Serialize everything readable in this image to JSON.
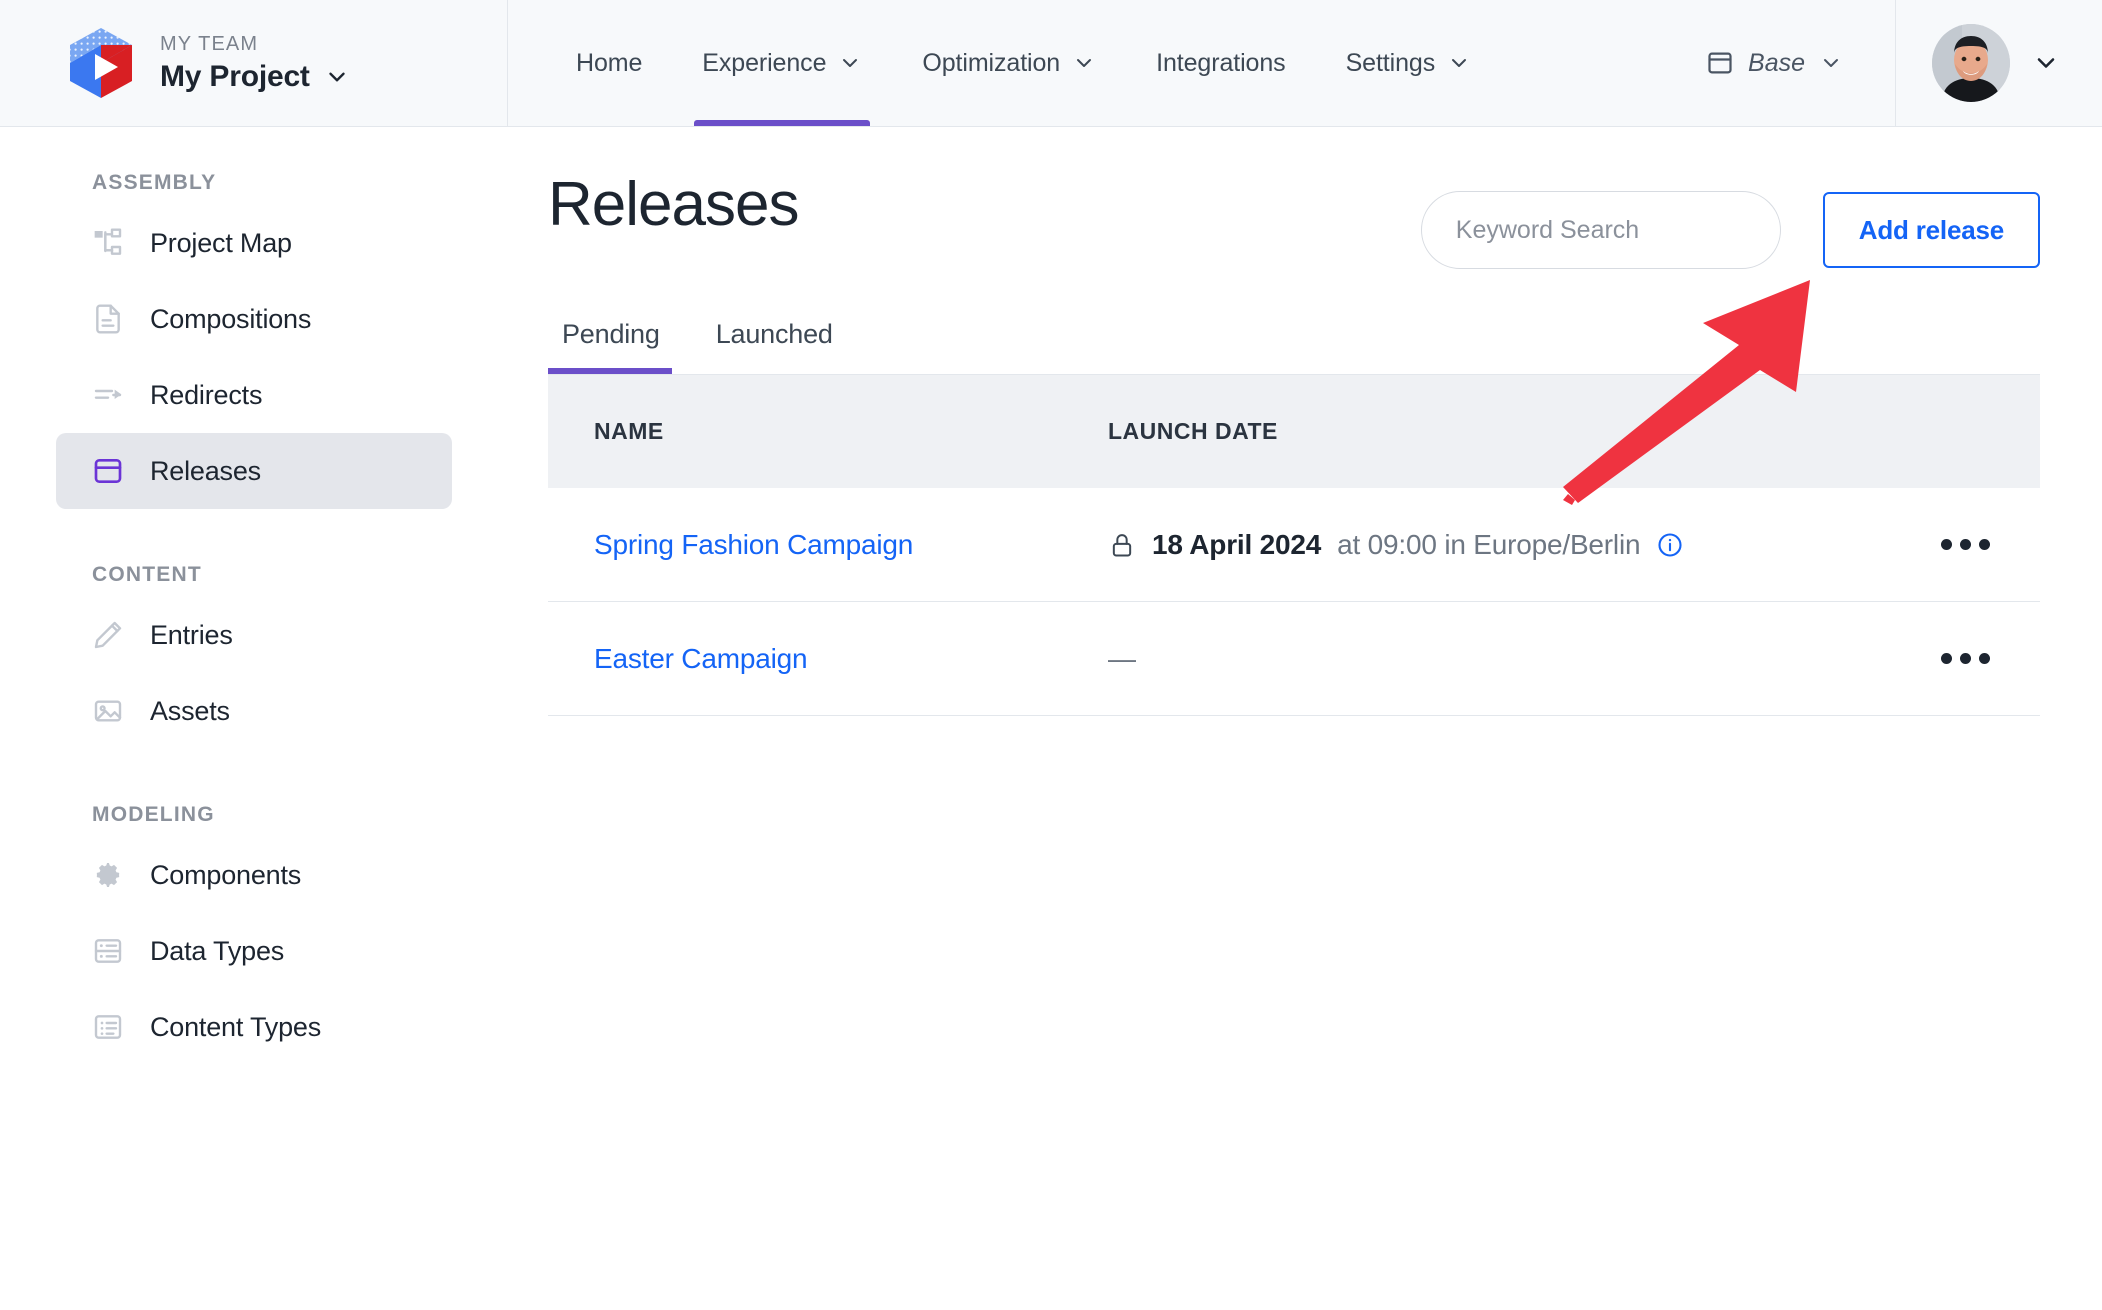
{
  "brand": {
    "team_label": "MY TEAM",
    "project_name": "My Project",
    "logo_icon": "cube-play-logo",
    "project_chevron_icon": "chevron-down-icon"
  },
  "topnav": {
    "items": [
      {
        "label": "Home",
        "has_chevron": false,
        "active": false
      },
      {
        "label": "Experience",
        "has_chevron": true,
        "active": true
      },
      {
        "label": "Optimization",
        "has_chevron": true,
        "active": false
      },
      {
        "label": "Integrations",
        "has_chevron": false,
        "active": false
      },
      {
        "label": "Settings",
        "has_chevron": true,
        "active": false
      }
    ],
    "base_selector": {
      "label": "Base",
      "icon": "window-panel-icon",
      "chevron_icon": "chevron-down-icon"
    },
    "user_menu": {
      "avatar_icon": "user-avatar-photo",
      "chevron_icon": "chevron-down-icon"
    },
    "active_accent": "#6b4fc9"
  },
  "sidebar": {
    "groups": [
      {
        "title": "ASSEMBLY",
        "items": [
          {
            "label": "Project Map",
            "icon": "sitemap-icon",
            "active": false
          },
          {
            "label": "Compositions",
            "icon": "document-lines-icon",
            "active": false
          },
          {
            "label": "Redirects",
            "icon": "arrow-right-dashed-icon",
            "active": false
          },
          {
            "label": "Releases",
            "icon": "calendar-panel-icon",
            "active": true
          }
        ]
      },
      {
        "title": "CONTENT",
        "items": [
          {
            "label": "Entries",
            "icon": "pencil-icon",
            "active": false
          },
          {
            "label": "Assets",
            "icon": "image-icon",
            "active": false
          }
        ]
      },
      {
        "title": "MODELING",
        "items": [
          {
            "label": "Components",
            "icon": "gear-icon",
            "active": false
          },
          {
            "label": "Data Types",
            "icon": "data-list-icon",
            "active": false
          },
          {
            "label": "Content Types",
            "icon": "content-list-icon",
            "active": false
          }
        ]
      }
    ]
  },
  "main": {
    "page_title": "Releases",
    "search": {
      "placeholder": "Keyword Search",
      "value": "",
      "icon": "search-icon"
    },
    "add_release_label": "Add release",
    "tabs": [
      {
        "label": "Pending",
        "active": true
      },
      {
        "label": "Launched",
        "active": false
      }
    ],
    "table": {
      "columns": [
        "NAME",
        "LAUNCH DATE"
      ],
      "rows": [
        {
          "name": "Spring Fashion Campaign",
          "lock_icon": "lock-icon",
          "date": "18 April 2024",
          "time_text": "at 09:00 in Europe/Berlin",
          "info_icon": "info-circle-icon",
          "menu_icon": "kebab-menu-icon"
        },
        {
          "name": "Easter Campaign",
          "lock_icon": "",
          "date": "—",
          "time_text": "",
          "info_icon": "",
          "menu_icon": "kebab-menu-icon"
        }
      ]
    }
  },
  "annotation": {
    "arrow_color": "#ef3340",
    "arrow_target": "add-release-button"
  }
}
